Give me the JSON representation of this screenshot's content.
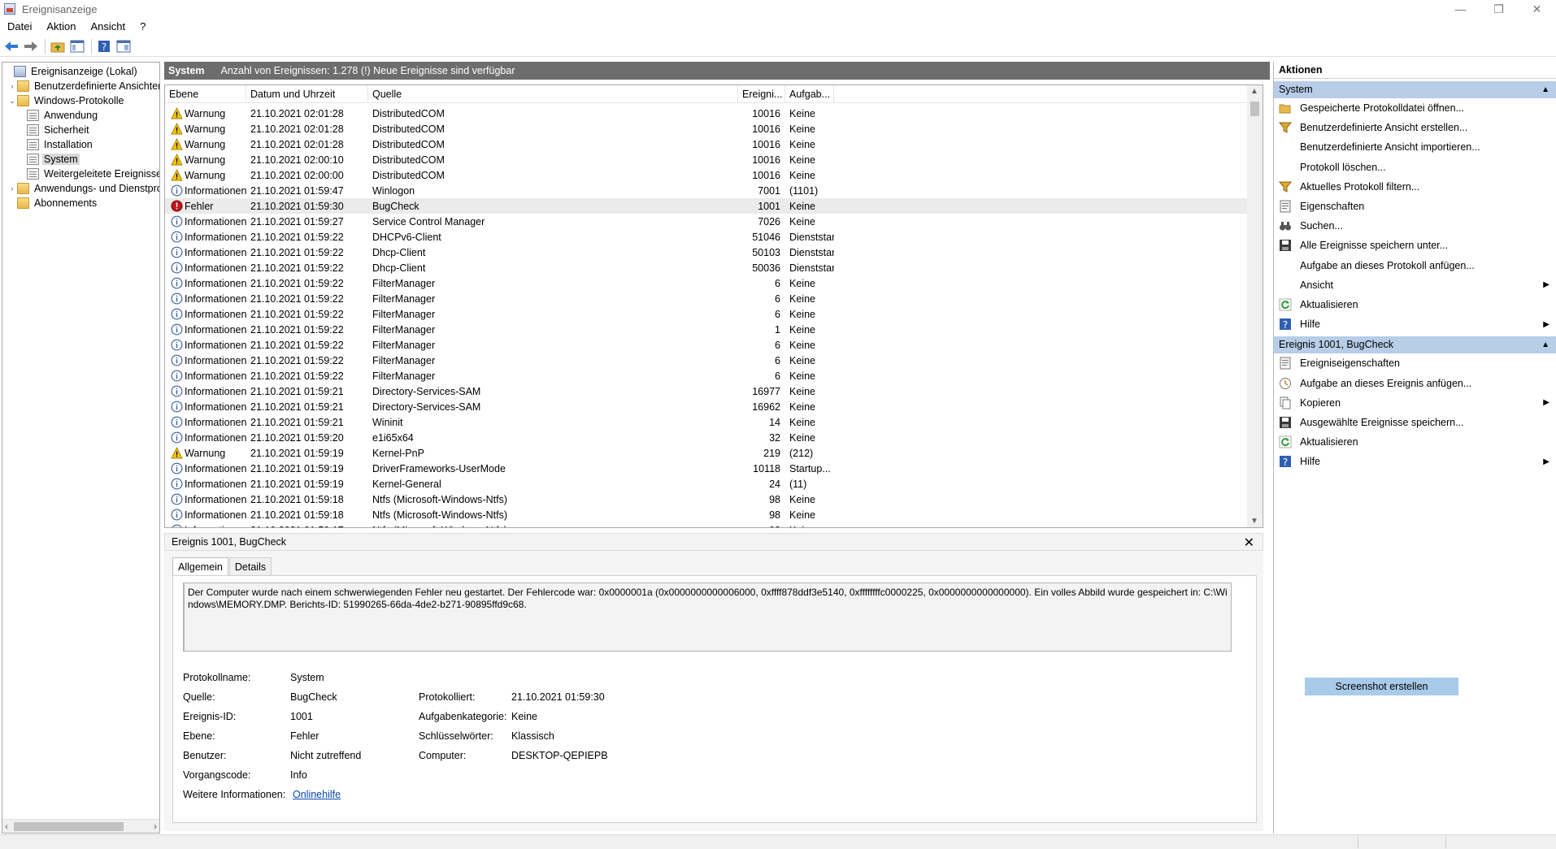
{
  "window": {
    "title": "Ereignisanzeige",
    "minimize": "—",
    "restore": "❐",
    "close": "✕"
  },
  "menu": [
    "Datei",
    "Aktion",
    "Ansicht",
    "?"
  ],
  "tree": {
    "items": [
      {
        "label": "Ereignisanzeige (Lokal)",
        "level": 0,
        "icon": "event-viewer-icon",
        "expander": ""
      },
      {
        "label": "Benutzerdefinierte Ansichten",
        "level": 1,
        "icon": "folder-icon",
        "expander": "›"
      },
      {
        "label": "Windows-Protokolle",
        "level": 1,
        "icon": "folder-icon",
        "expander": "⌄"
      },
      {
        "label": "Anwendung",
        "level": 2,
        "icon": "log-icon",
        "expander": ""
      },
      {
        "label": "Sicherheit",
        "level": 2,
        "icon": "log-icon",
        "expander": ""
      },
      {
        "label": "Installation",
        "level": 2,
        "icon": "log-icon",
        "expander": ""
      },
      {
        "label": "System",
        "level": 2,
        "icon": "log-icon",
        "expander": "",
        "selected": true
      },
      {
        "label": "Weitergeleitete Ereignisse",
        "level": 2,
        "icon": "log-icon",
        "expander": ""
      },
      {
        "label": "Anwendungs- und Dienstprotokolle",
        "level": 1,
        "icon": "folder-icon",
        "expander": "›"
      },
      {
        "label": "Abonnements",
        "level": 1,
        "icon": "folder-icon",
        "expander": ""
      }
    ]
  },
  "center": {
    "title": "System",
    "summary": "Anzahl von Ereignissen: 1.278 (!) Neue Ereignisse sind verfügbar"
  },
  "table": {
    "columns": [
      "Ebene",
      "Datum und Uhrzeit",
      "Quelle",
      "Ereigni...",
      "Aufgab..."
    ],
    "rows": [
      {
        "level": "Warnung",
        "type": "warning",
        "date": "21.10.2021 02:01:28",
        "source": "DistributedCOM",
        "id": "10016",
        "task": "Keine"
      },
      {
        "level": "Warnung",
        "type": "warning",
        "date": "21.10.2021 02:01:28",
        "source": "DistributedCOM",
        "id": "10016",
        "task": "Keine"
      },
      {
        "level": "Warnung",
        "type": "warning",
        "date": "21.10.2021 02:01:28",
        "source": "DistributedCOM",
        "id": "10016",
        "task": "Keine"
      },
      {
        "level": "Warnung",
        "type": "warning",
        "date": "21.10.2021 02:00:10",
        "source": "DistributedCOM",
        "id": "10016",
        "task": "Keine"
      },
      {
        "level": "Warnung",
        "type": "warning",
        "date": "21.10.2021 02:00:00",
        "source": "DistributedCOM",
        "id": "10016",
        "task": "Keine"
      },
      {
        "level": "Informationen",
        "type": "info",
        "date": "21.10.2021 01:59:47",
        "source": "Winlogon",
        "id": "7001",
        "task": "(1101)"
      },
      {
        "level": "Fehler",
        "type": "error",
        "date": "21.10.2021 01:59:30",
        "source": "BugCheck",
        "id": "1001",
        "task": "Keine",
        "selected": true
      },
      {
        "level": "Informationen",
        "type": "info",
        "date": "21.10.2021 01:59:27",
        "source": "Service Control Manager",
        "id": "7026",
        "task": "Keine"
      },
      {
        "level": "Informationen",
        "type": "info",
        "date": "21.10.2021 01:59:22",
        "source": "DHCPv6-Client",
        "id": "51046",
        "task": "Dienststartvorgang"
      },
      {
        "level": "Informationen",
        "type": "info",
        "date": "21.10.2021 01:59:22",
        "source": "Dhcp-Client",
        "id": "50103",
        "task": "Dienststartvorgang"
      },
      {
        "level": "Informationen",
        "type": "info",
        "date": "21.10.2021 01:59:22",
        "source": "Dhcp-Client",
        "id": "50036",
        "task": "Dienststartvorgang"
      },
      {
        "level": "Informationen",
        "type": "info",
        "date": "21.10.2021 01:59:22",
        "source": "FilterManager",
        "id": "6",
        "task": "Keine"
      },
      {
        "level": "Informationen",
        "type": "info",
        "date": "21.10.2021 01:59:22",
        "source": "FilterManager",
        "id": "6",
        "task": "Keine"
      },
      {
        "level": "Informationen",
        "type": "info",
        "date": "21.10.2021 01:59:22",
        "source": "FilterManager",
        "id": "6",
        "task": "Keine"
      },
      {
        "level": "Informationen",
        "type": "info",
        "date": "21.10.2021 01:59:22",
        "source": "FilterManager",
        "id": "1",
        "task": "Keine"
      },
      {
        "level": "Informationen",
        "type": "info",
        "date": "21.10.2021 01:59:22",
        "source": "FilterManager",
        "id": "6",
        "task": "Keine"
      },
      {
        "level": "Informationen",
        "type": "info",
        "date": "21.10.2021 01:59:22",
        "source": "FilterManager",
        "id": "6",
        "task": "Keine"
      },
      {
        "level": "Informationen",
        "type": "info",
        "date": "21.10.2021 01:59:22",
        "source": "FilterManager",
        "id": "6",
        "task": "Keine"
      },
      {
        "level": "Informationen",
        "type": "info",
        "date": "21.10.2021 01:59:21",
        "source": "Directory-Services-SAM",
        "id": "16977",
        "task": "Keine"
      },
      {
        "level": "Informationen",
        "type": "info",
        "date": "21.10.2021 01:59:21",
        "source": "Directory-Services-SAM",
        "id": "16962",
        "task": "Keine"
      },
      {
        "level": "Informationen",
        "type": "info",
        "date": "21.10.2021 01:59:21",
        "source": "Wininit",
        "id": "14",
        "task": "Keine"
      },
      {
        "level": "Informationen",
        "type": "info",
        "date": "21.10.2021 01:59:20",
        "source": "e1i65x64",
        "id": "32",
        "task": "Keine"
      },
      {
        "level": "Warnung",
        "type": "warning",
        "date": "21.10.2021 01:59:19",
        "source": "Kernel-PnP",
        "id": "219",
        "task": "(212)"
      },
      {
        "level": "Informationen",
        "type": "info",
        "date": "21.10.2021 01:59:19",
        "source": "DriverFrameworks-UserMode",
        "id": "10118",
        "task": "Startup..."
      },
      {
        "level": "Informationen",
        "type": "info",
        "date": "21.10.2021 01:59:19",
        "source": "Kernel-General",
        "id": "24",
        "task": "(11)"
      },
      {
        "level": "Informationen",
        "type": "info",
        "date": "21.10.2021 01:59:18",
        "source": "Ntfs (Microsoft-Windows-Ntfs)",
        "id": "98",
        "task": "Keine"
      },
      {
        "level": "Informationen",
        "type": "info",
        "date": "21.10.2021 01:59:18",
        "source": "Ntfs (Microsoft-Windows-Ntfs)",
        "id": "98",
        "task": "Keine"
      },
      {
        "level": "Informationen",
        "type": "info",
        "date": "21.10.2021 01:59:17",
        "source": "Ntfs (Microsoft-Windows-Ntfs)",
        "id": "98",
        "task": "Keine"
      }
    ]
  },
  "detail": {
    "title": "Ereignis 1001, BugCheck",
    "tabs": [
      "Allgemein",
      "Details"
    ],
    "description": "Der Computer wurde nach einem schwerwiegenden Fehler neu gestartet. Der Fehlercode war: 0x0000001a (0x0000000000006000, 0xffff878ddf3e5140, 0xffffffffc0000225, 0x0000000000000000). Ein volles Abbild wurde gespeichert in: C:\\Windows\\MEMORY.DMP. Berichts-ID: 51990265-66da-4de2-b271-90895ffd9c68.",
    "fields": {
      "log_name_label": "Protokollname:",
      "log_name": "System",
      "source_label": "Quelle:",
      "source": "BugCheck",
      "logged_label": "Protokolliert:",
      "logged": "21.10.2021 01:59:30",
      "event_id_label": "Ereignis-ID:",
      "event_id": "1001",
      "task_cat_label": "Aufgabenkategorie:",
      "task_cat": "Keine",
      "level_label": "Ebene:",
      "level": "Fehler",
      "keywords_label": "Schlüsselwörter:",
      "keywords": "Klassisch",
      "user_label": "Benutzer:",
      "user": "Nicht zutreffend",
      "computer_label": "Computer:",
      "computer": "DESKTOP-QEPIEPB",
      "opcode_label": "Vorgangscode:",
      "opcode": "Info",
      "more_info_label": "Weitere Informationen:",
      "more_info_link": "Onlinehilfe"
    }
  },
  "actions": {
    "title": "Aktionen",
    "section1": {
      "title": "System",
      "items": [
        {
          "label": "Gespeicherte Protokolldatei öffnen...",
          "icon": "open-folder-icon"
        },
        {
          "label": "Benutzerdefinierte Ansicht erstellen...",
          "icon": "filter-icon"
        },
        {
          "label": "Benutzerdefinierte Ansicht importieren...",
          "icon": ""
        },
        {
          "label": "Protokoll löschen...",
          "icon": ""
        },
        {
          "label": "Aktuelles Protokoll filtern...",
          "icon": "filter-icon"
        },
        {
          "label": "Eigenschaften",
          "icon": "properties-icon"
        },
        {
          "label": "Suchen...",
          "icon": "binoculars-icon"
        },
        {
          "label": "Alle Ereignisse speichern unter...",
          "icon": "save-icon"
        },
        {
          "label": "Aufgabe an dieses Protokoll anfügen...",
          "icon": ""
        },
        {
          "label": "Ansicht",
          "icon": "",
          "submenu": true
        },
        {
          "label": "Aktualisieren",
          "icon": "refresh-icon"
        },
        {
          "label": "Hilfe",
          "icon": "help-icon",
          "submenu": true
        }
      ]
    },
    "section2": {
      "title": "Ereignis 1001, BugCheck",
      "items": [
        {
          "label": "Ereigniseigenschaften",
          "icon": "properties-icon"
        },
        {
          "label": "Aufgabe an dieses Ereignis anfügen...",
          "icon": "task-icon"
        },
        {
          "label": "Kopieren",
          "icon": "copy-icon",
          "submenu": true
        },
        {
          "label": "Ausgewählte Ereignisse speichern...",
          "icon": "save-icon"
        },
        {
          "label": "Aktualisieren",
          "icon": "refresh-icon"
        },
        {
          "label": "Hilfe",
          "icon": "help-icon",
          "submenu": true
        }
      ]
    },
    "screenshot_button": "Screenshot erstellen"
  },
  "colors": {
    "header_bg": "#6d6d6d",
    "section_bg": "#b7cde8",
    "warning": "#f4c400",
    "error": "#c4161c",
    "info": "#3c5a99",
    "link": "#0645ad"
  }
}
